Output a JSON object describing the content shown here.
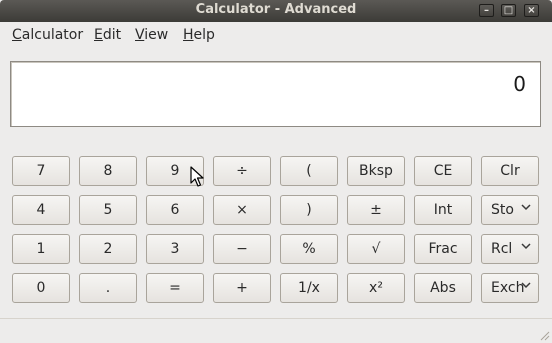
{
  "window": {
    "title": "Calculator - Advanced"
  },
  "window_controls": {
    "minimize": "–",
    "maximize": "□",
    "close": "×"
  },
  "menu": [
    {
      "label": "Calculator",
      "mnemonic": "C",
      "rest": "alculator"
    },
    {
      "label": "Edit",
      "mnemonic": "E",
      "rest": "dit"
    },
    {
      "label": "View",
      "mnemonic": "V",
      "rest": "iew"
    },
    {
      "label": "Help",
      "mnemonic": "H",
      "rest": "elp"
    }
  ],
  "display": {
    "value": "0"
  },
  "buttons": {
    "row1": [
      "7",
      "8",
      "9",
      "÷",
      "(",
      "Bksp",
      "CE",
      "Clr"
    ],
    "row2": [
      "4",
      "5",
      "6",
      "×",
      ")",
      "±",
      "Int",
      "Sto"
    ],
    "row3": [
      "1",
      "2",
      "3",
      "−",
      "%",
      "√",
      "Frac",
      "Rcl"
    ],
    "row4": [
      "0",
      ".",
      "=",
      "+",
      "1/x",
      "x²",
      "Abs",
      "Exch"
    ]
  },
  "icons": {
    "dropdown": "chevron-down-icon",
    "cursor": "mouse-pointer-icon",
    "resize": "resize-grip-icon"
  }
}
